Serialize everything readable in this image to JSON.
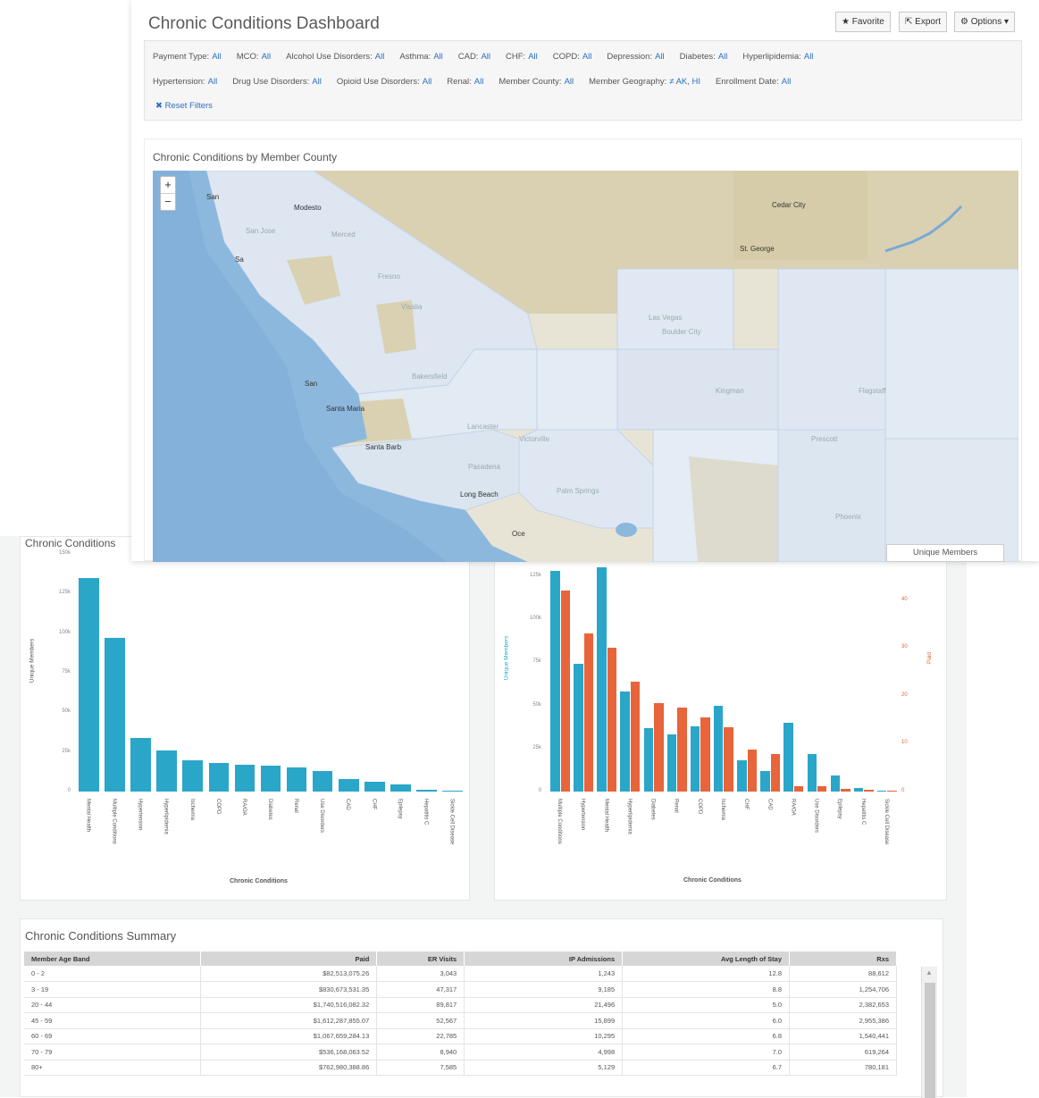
{
  "dashboard": {
    "title": "Chronic Conditions Dashboard",
    "buttons": {
      "favorite": "Favorite",
      "export": "Export",
      "options": "Options"
    },
    "filters_row1": [
      {
        "label": "Payment Type:",
        "value": "All"
      },
      {
        "label": "MCO:",
        "value": "All"
      },
      {
        "label": "Alcohol Use Disorders:",
        "value": "All"
      },
      {
        "label": "Asthma:",
        "value": "All"
      },
      {
        "label": "CAD:",
        "value": "All"
      },
      {
        "label": "CHF:",
        "value": "All"
      },
      {
        "label": "COPD:",
        "value": "All"
      },
      {
        "label": "Depression:",
        "value": "All"
      },
      {
        "label": "Diabetes:",
        "value": "All"
      },
      {
        "label": "Hyperlipidemia:",
        "value": "All"
      }
    ],
    "filters_row2": [
      {
        "label": "Hypertension:",
        "value": "All"
      },
      {
        "label": "Drug Use Disorders:",
        "value": "All"
      },
      {
        "label": "Opioid Use Disorders:",
        "value": "All"
      },
      {
        "label": "Renal:",
        "value": "All"
      },
      {
        "label": "Member County:",
        "value": "All"
      },
      {
        "label": "Member Geography:",
        "value": "≠ AK, HI"
      },
      {
        "label": "Enrollment Date:",
        "value": "All"
      }
    ],
    "reset_filters": "✖ Reset Filters"
  },
  "map": {
    "title": "Chronic Conditions by Member County",
    "zoom_in": "+",
    "zoom_out": "−",
    "legend_label": "Unique Members",
    "cities": [
      "San",
      "Modesto",
      "Sa",
      "Visalia",
      "San",
      "Santa Maria",
      "Santa Barb",
      "Long Beach",
      "Oce",
      "Cedar City",
      "St. George",
      "Las Vegas",
      "Boulder City",
      "Bakersfield",
      "Lancaster",
      "Victorville",
      "Pasadena",
      "Palm Springs",
      "Kingman",
      "Flagstaff",
      "Prescott",
      "Phoenix",
      "Fresno",
      "Merced",
      "San Jose"
    ],
    "colors": {
      "ocean": "#8db8de",
      "land": "#d6cfb4",
      "county": "#dfe8f2",
      "county_border": "#c4d3e6"
    }
  },
  "left_chart": {
    "title_visible": "Chronic Conditions",
    "colors": {
      "bar": "#2aa6c9"
    }
  },
  "right_chart": {
    "colors": {
      "members": "#2aa6c9",
      "paid": "#e8643a"
    }
  },
  "chart_data": [
    {
      "type": "bar",
      "title": "Chronic Conditions",
      "xlabel": "Chronic Conditions",
      "ylabel": "Unique Members",
      "ylim": [
        0,
        150000
      ],
      "yticks": [
        "0",
        "25k",
        "50k",
        "75k",
        "100k",
        "125k",
        "150k"
      ],
      "categories": [
        "Mental Health",
        "Multiple Conditions",
        "Hypertension",
        "Hyperlipidemia",
        "Ischemia",
        "COPD",
        "RA/OA",
        "Diabetes",
        "Renal",
        "Use Disorders",
        "CAD",
        "CHF",
        "Epilepsy",
        "Hepatitis C",
        "Sickle Cell Disease"
      ],
      "series": [
        {
          "name": "Unique Members",
          "values": [
            135000,
            97000,
            34000,
            26000,
            20000,
            18000,
            17000,
            16500,
            15500,
            13000,
            8000,
            6000,
            4500,
            1000,
            500
          ]
        }
      ]
    },
    {
      "type": "bar",
      "xlabel": "Chronic Conditions",
      "ylabel": "Unique Members",
      "y2label": "Paid",
      "ylim": [
        0,
        125000
      ],
      "y2lim": [
        0,
        45
      ],
      "yticks": [
        "0",
        "25k",
        "50k",
        "75k",
        "100k",
        "125k"
      ],
      "y2ticks": [
        "0",
        "10",
        "20",
        "30",
        "40"
      ],
      "categories": [
        "Multiple Conditions",
        "Hypertension",
        "Mental Health",
        "Hyperlipidemia",
        "Diabetes",
        "Renal",
        "COPD",
        "Ischemia",
        "CHF",
        "CAD",
        "RA/OA",
        "Use Disorders",
        "Epilepsy",
        "Hepatitis C",
        "Sickle Cell Disease"
      ],
      "series": [
        {
          "name": "Unique Members",
          "axis": "left",
          "values": [
            128000,
            74000,
            135000,
            58000,
            37000,
            33000,
            38000,
            50000,
            18000,
            12000,
            40000,
            22000,
            9500,
            2000,
            500
          ]
        },
        {
          "name": "Paid",
          "axis": "right",
          "values": [
            42,
            33,
            30,
            23,
            18.5,
            17.5,
            15.5,
            13.5,
            8.8,
            7.8,
            1.2,
            1.2,
            0.5,
            0.3,
            0.1
          ]
        }
      ]
    }
  ],
  "summary": {
    "title": "Chronic Conditions Summary",
    "columns": [
      "Member Age Band",
      "Paid",
      "ER Visits",
      "IP Admissions",
      "Avg Length of Stay",
      "Rxs"
    ],
    "rows": [
      [
        "0 - 2",
        "$82,513,075.26",
        "3,043",
        "1,243",
        "12.8",
        "88,612"
      ],
      [
        "3 - 19",
        "$830,673,531.35",
        "47,317",
        "9,185",
        "8.8",
        "1,254,706"
      ],
      [
        "20 - 44",
        "$1,740,516,082.32",
        "89,817",
        "21,496",
        "5.0",
        "2,382,653"
      ],
      [
        "45 - 59",
        "$1,612,287,855.07",
        "52,567",
        "15,899",
        "6.0",
        "2,955,386"
      ],
      [
        "60 - 69",
        "$1,067,659,284.13",
        "22,785",
        "10,295",
        "6.8",
        "1,540,441"
      ],
      [
        "70 - 79",
        "$536,168,063.52",
        "8,940",
        "4,998",
        "7.0",
        "619,264"
      ],
      [
        "80+",
        "$762,980,388.86",
        "7,585",
        "5,129",
        "6.7",
        "780,181"
      ]
    ]
  }
}
